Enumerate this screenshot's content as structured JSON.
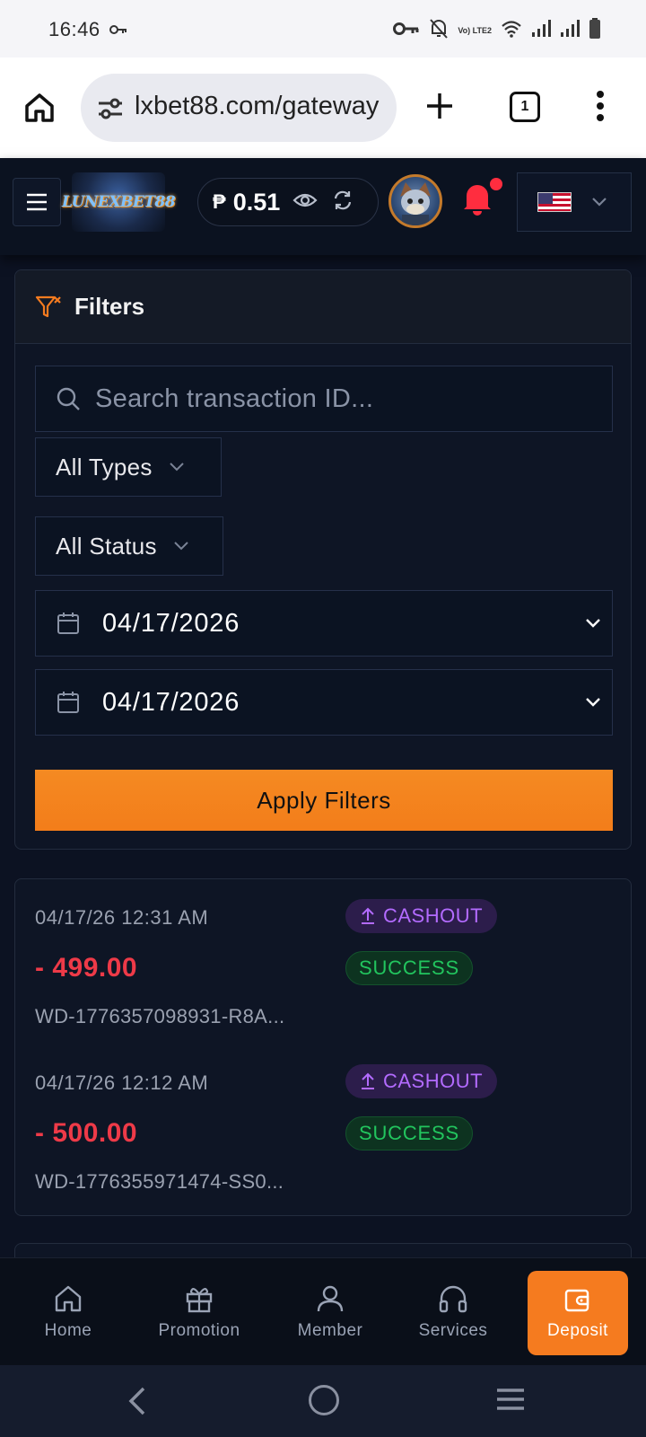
{
  "status_bar": {
    "time": "16:46",
    "network_label": "Vo) LTE2"
  },
  "browser": {
    "url": "lxbet88.com/gateway",
    "tab_count": "1"
  },
  "header": {
    "logo_text": "LUNEXBET88",
    "currency_symbol": "₱",
    "balance": "0.51"
  },
  "filters": {
    "title": "Filters",
    "search_placeholder": "Search transaction ID...",
    "type_select": "All Types",
    "status_select": "All Status",
    "date_from": "04/17/2026",
    "date_to": "04/17/2026",
    "apply_label": "Apply Filters"
  },
  "transactions": [
    {
      "datetime": "04/17/26 12:31 AM",
      "amount": "- 499.00",
      "id": "WD-1776357098931-R8A...",
      "type": "CASHOUT",
      "status": "SUCCESS"
    },
    {
      "datetime": "04/17/26 12:12 AM",
      "amount": "- 500.00",
      "id": "WD-1776355971474-SS0...",
      "type": "CASHOUT",
      "status": "SUCCESS"
    }
  ],
  "bottom_nav": {
    "home": "Home",
    "promotion": "Promotion",
    "member": "Member",
    "services": "Services",
    "deposit": "Deposit"
  },
  "colors": {
    "accent": "#f57b1f",
    "background": "#0c1222",
    "negative_amount": "#ee3a48",
    "success": "#22c55e",
    "cashout": "#b36bff"
  }
}
